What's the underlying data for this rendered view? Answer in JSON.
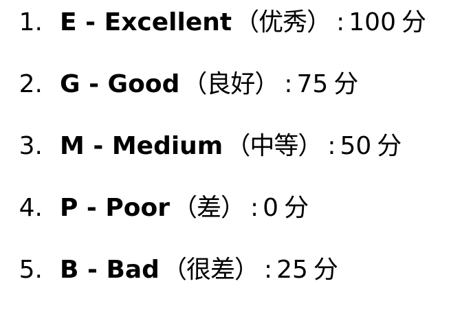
{
  "grades": [
    {
      "index": "1.",
      "term": "E - Excellent",
      "note": "（优秀）",
      "separator": ":",
      "score": "100",
      "unit": "分"
    },
    {
      "index": "2.",
      "term": "G - Good",
      "note": "（良好）",
      "separator": ":",
      "score": "75",
      "unit": "分"
    },
    {
      "index": "3.",
      "term": "M - Medium",
      "note": "（中等）",
      "separator": ":",
      "score": "50",
      "unit": "分"
    },
    {
      "index": "4.",
      "term": "P - Poor",
      "note": "（差）",
      "separator": ":",
      "score": "0",
      "unit": "分"
    },
    {
      "index": "5.",
      "term": "B - Bad",
      "note": "（很差）",
      "separator": ":",
      "score": "25",
      "unit": "分"
    }
  ]
}
